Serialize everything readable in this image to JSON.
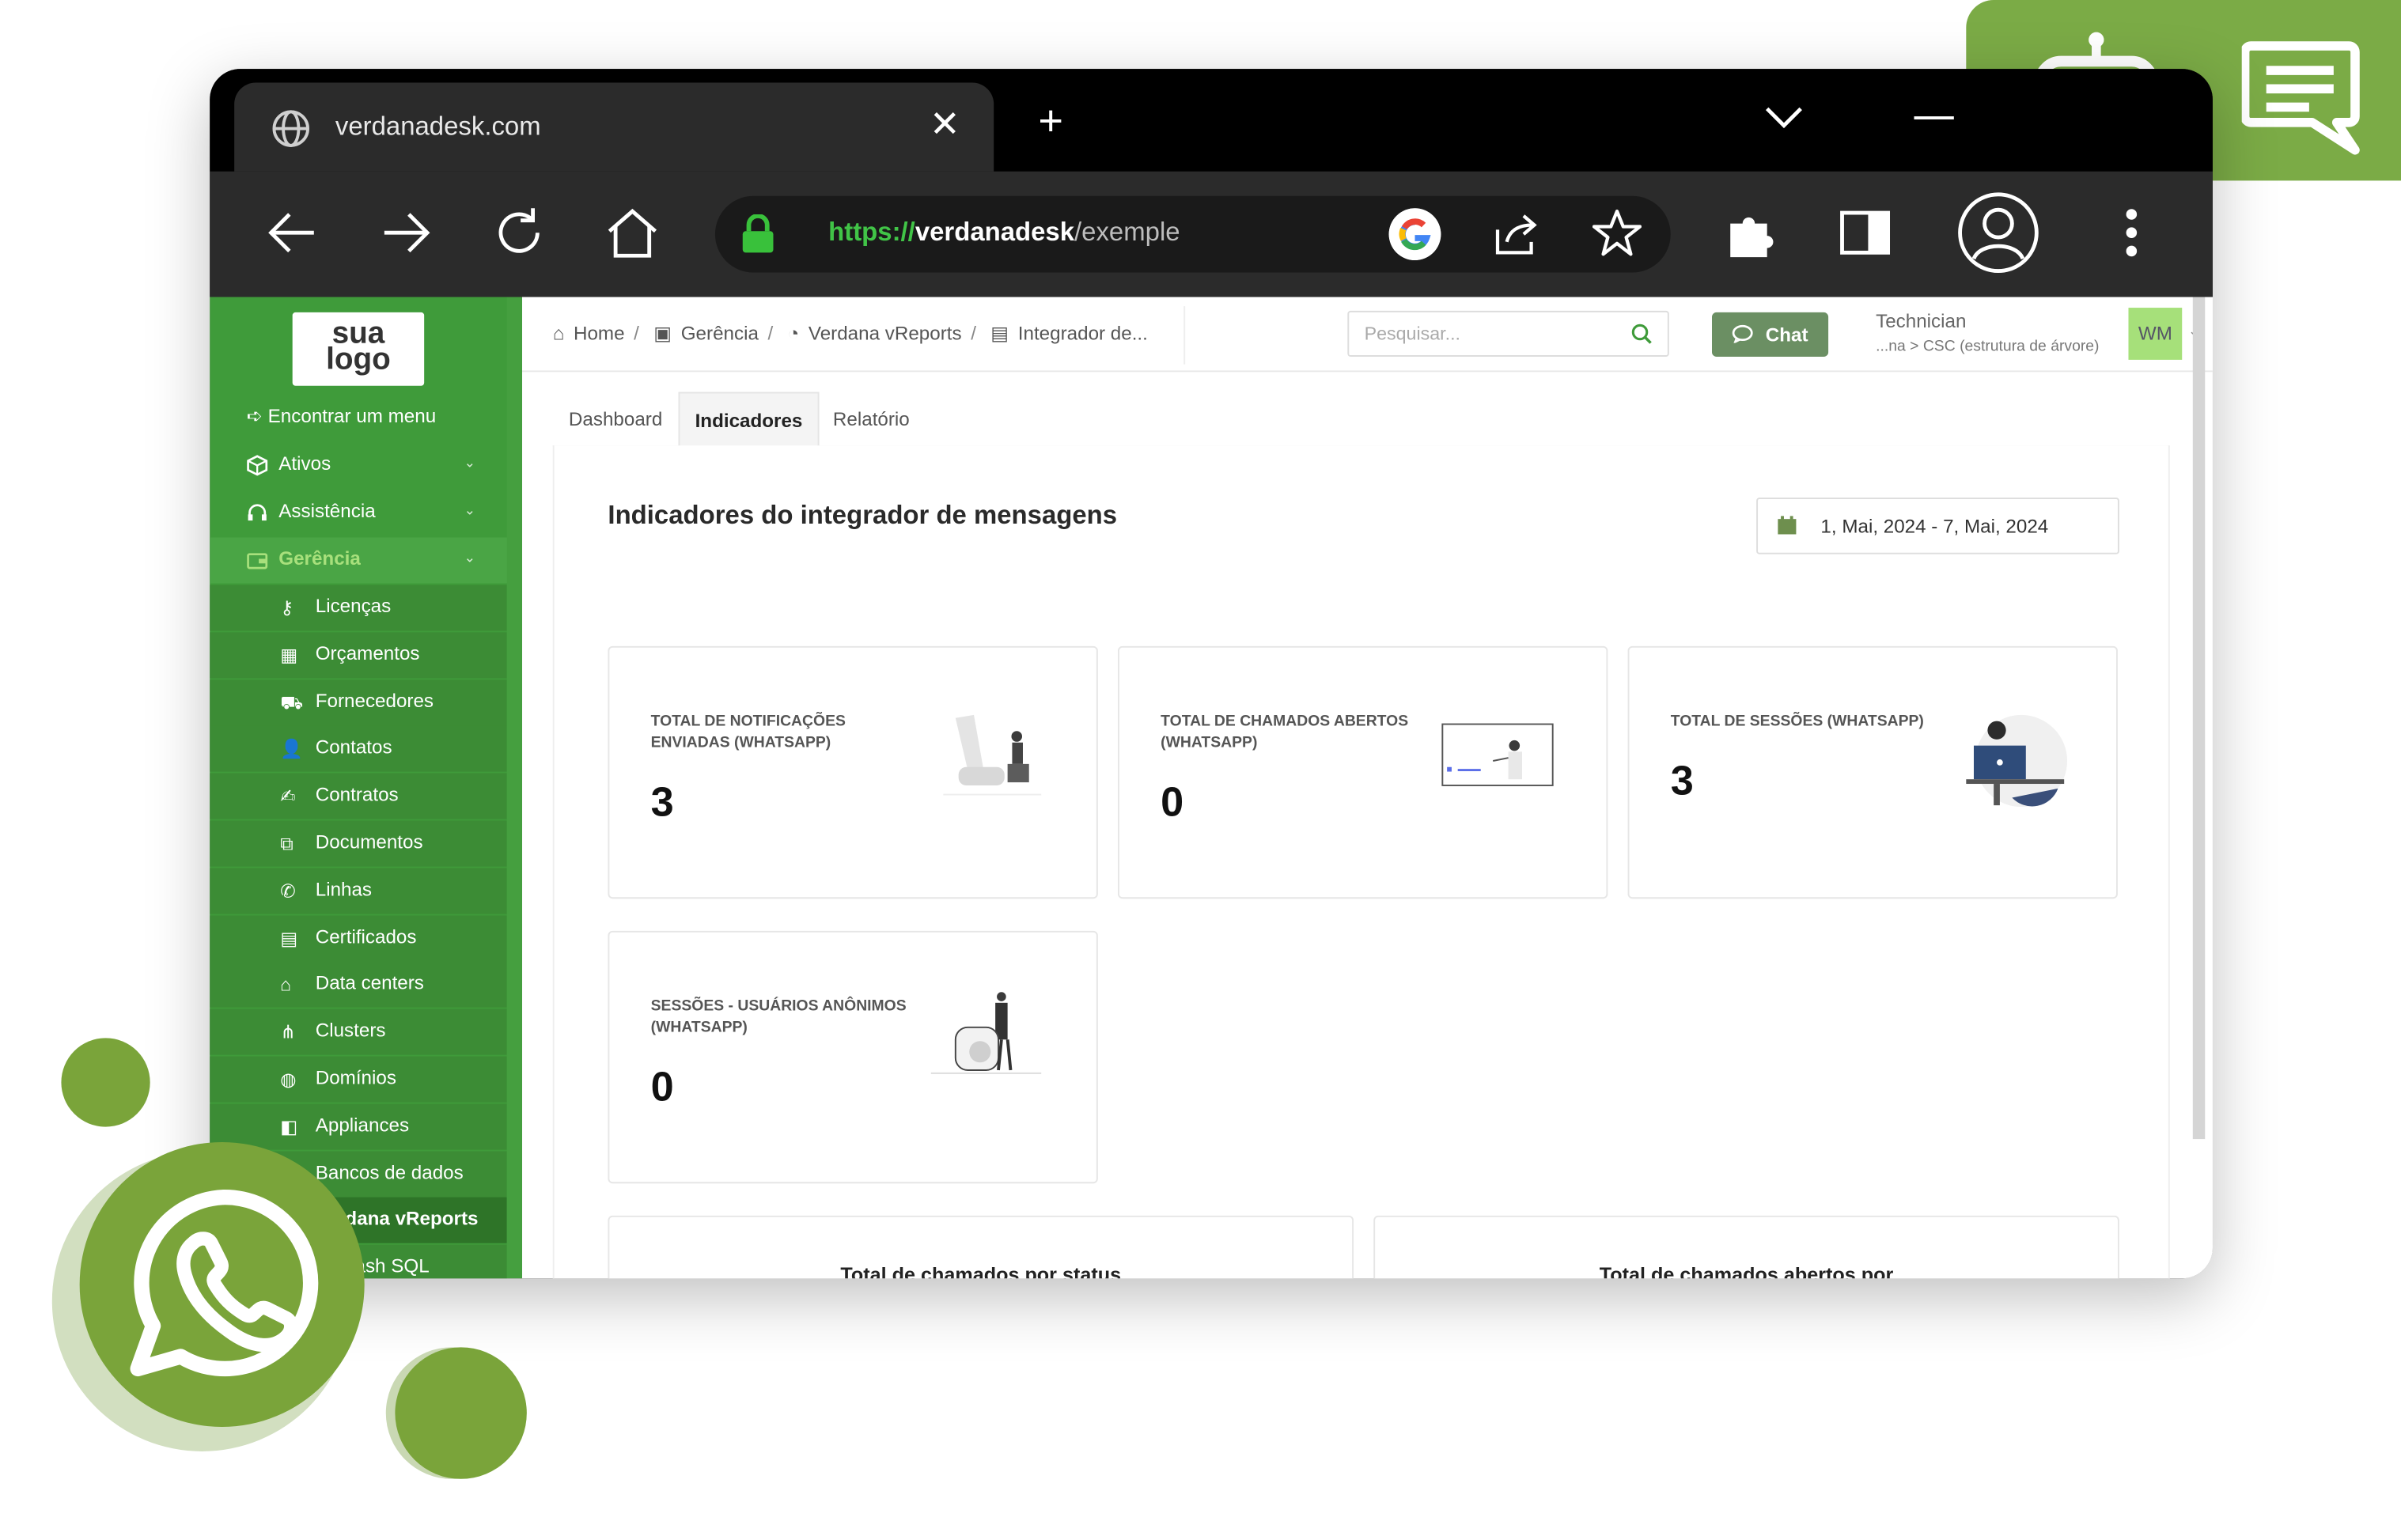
{
  "browser": {
    "tab_title": "verdanadesk.com",
    "tab_close": "✕",
    "new_tab": "+",
    "url_scheme": "https://",
    "url_host": "verdanadesk",
    "url_path": "/exemple"
  },
  "sidebar": {
    "logo_line1": "sua",
    "logo_line2": "logo",
    "find_menu": "Encontrar um menu",
    "items": [
      {
        "label": "Ativos",
        "icon": "cube-icon"
      },
      {
        "label": "Assistência",
        "icon": "headset-icon"
      },
      {
        "label": "Gerência",
        "icon": "wallet-icon"
      }
    ],
    "subitems": [
      {
        "label": "Licenças",
        "icon": "key-icon"
      },
      {
        "label": "Orçamentos",
        "icon": "calculator-icon"
      },
      {
        "label": "Fornecedores",
        "icon": "dolly-icon"
      },
      {
        "label": "Contatos",
        "icon": "user-icon"
      },
      {
        "label": "Contratos",
        "icon": "signature-icon"
      },
      {
        "label": "Documentos",
        "icon": "files-icon"
      },
      {
        "label": "Linhas",
        "icon": "phone-icon"
      },
      {
        "label": "Certificados",
        "icon": "certificate-icon"
      },
      {
        "label": "Data centers",
        "icon": "building-icon"
      },
      {
        "label": "Clusters",
        "icon": "network-icon"
      },
      {
        "label": "Domínios",
        "icon": "globe-icon"
      },
      {
        "label": "Appliances",
        "icon": "appliance-icon"
      },
      {
        "label": "Bancos de dados",
        "icon": "database-icon"
      },
      {
        "label": "Verdana vReports",
        "icon": "report-icon"
      },
      {
        "label": "Verdash SQL",
        "icon": "sql-icon"
      }
    ]
  },
  "topbar": {
    "breadcrumbs": [
      "Home",
      "Gerência",
      "Verdana vReports",
      "Integrador de..."
    ],
    "search_placeholder": "Pesquisar...",
    "chat_label": "Chat",
    "user_role": "Technician",
    "user_entity": "...na > CSC (estrutura de árvore)",
    "avatar_initials": "WM"
  },
  "tabs": [
    "Dashboard",
    "Indicadores",
    "Relatório"
  ],
  "active_tab": "Indicadores",
  "page": {
    "heading": "Indicadores do integrador de mensagens",
    "date_range": "1, Mai, 2024 - 7, Mai, 2024"
  },
  "cards": [
    {
      "label": "TOTAL DE NOTIFICAÇÕES ENVIADAS (WHATSAPP)",
      "value": "3"
    },
    {
      "label": "TOTAL DE CHAMADOS ABERTOS (WHATSAPP)",
      "value": "0"
    },
    {
      "label": "TOTAL DE SESSÕES (WHATSAPP)",
      "value": "3"
    },
    {
      "label": "SESSÕES - USUÁRIOS ANÔNIMOS (WHATSAPP)",
      "value": "0"
    }
  ],
  "chart_cards": [
    {
      "title": "Total de chamados por status"
    },
    {
      "title": "Total de chamados abertos por"
    }
  ],
  "colors": {
    "sidebar_green": "#3f9b3a",
    "accent_green": "#7aa43a",
    "url_green": "#41c447",
    "avatar_bg": "#a6e07a"
  }
}
